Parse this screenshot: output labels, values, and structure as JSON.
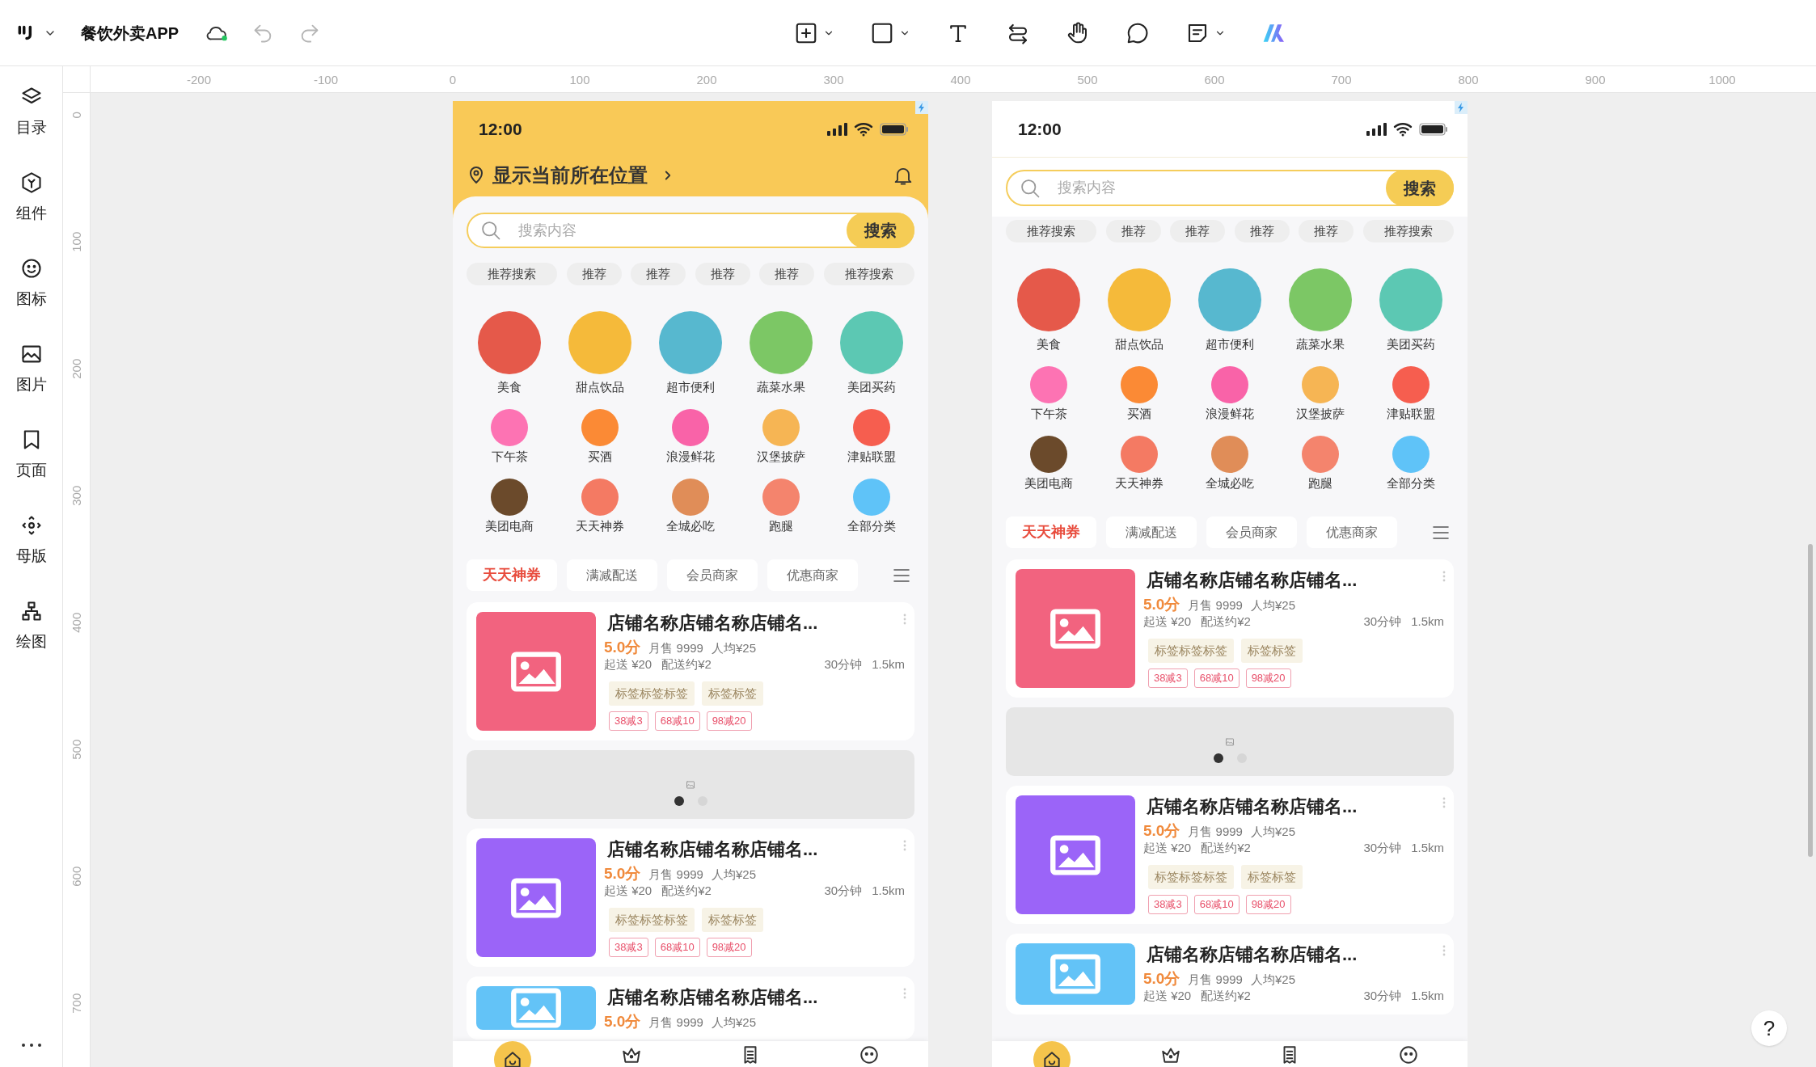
{
  "toolbar": {
    "title": "餐饮外卖APP"
  },
  "sidebar": {
    "items": [
      {
        "label": "目录",
        "kind": "layers"
      },
      {
        "label": "组件",
        "kind": "component"
      },
      {
        "label": "图标",
        "kind": "smiley"
      },
      {
        "label": "图片",
        "kind": "image"
      },
      {
        "label": "页面",
        "kind": "page"
      },
      {
        "label": "母版",
        "kind": "master"
      },
      {
        "label": "绘图",
        "kind": "drawing"
      }
    ]
  },
  "rulers": {
    "horizontal": [
      "-200",
      "-100",
      "0",
      "100",
      "200",
      "300",
      "400",
      "500",
      "600",
      "700",
      "800",
      "900",
      "1000"
    ],
    "vertical": [
      "0",
      "100",
      "200",
      "300",
      "400",
      "500",
      "600",
      "700"
    ]
  },
  "screens": [
    {
      "status_time": "12:00",
      "location": "显示当前所在位置",
      "search": {
        "placeholder": "搜索内容",
        "button": "搜索"
      },
      "chips": [
        "推荐搜索",
        "推荐",
        "推荐",
        "推荐",
        "推荐",
        "推荐搜索"
      ],
      "featured_categories": [
        {
          "label": "美食",
          "color": "#e5594a"
        },
        {
          "label": "甜点饮品",
          "color": "#f5ba3a"
        },
        {
          "label": "超市便利",
          "color": "#57b8cf"
        },
        {
          "label": "蔬菜水果",
          "color": "#7cc765"
        },
        {
          "label": "美团买药",
          "color": "#5cc8b3"
        }
      ],
      "categories": [
        {
          "label": "下午茶",
          "color": "#fd73b3"
        },
        {
          "label": "买酒",
          "color": "#fb8a35"
        },
        {
          "label": "浪漫鲜花",
          "color": "#f963a8"
        },
        {
          "label": "汉堡披萨",
          "color": "#f6b554"
        },
        {
          "label": "津贴联盟",
          "color": "#f65e4f"
        },
        {
          "label": "美团电商",
          "color": "#6b4a2b"
        },
        {
          "label": "天天神券",
          "color": "#f47a63"
        },
        {
          "label": "全城必吃",
          "color": "#e08d58"
        },
        {
          "label": "跑腿",
          "color": "#f4846d"
        },
        {
          "label": "全部分类",
          "color": "#5fc3f8"
        }
      ],
      "filter_tabs": [
        {
          "label": "天天神券",
          "selected": true
        },
        {
          "label": "满减配送",
          "selected": false
        },
        {
          "label": "会员商家",
          "selected": false
        },
        {
          "label": "优惠商家",
          "selected": false
        }
      ],
      "feed": [
        {
          "kind": "store",
          "color": "#f2637f",
          "name": "店铺名称店铺名称店铺名...",
          "rating": "5.0分",
          "sales": "月售 9999",
          "average_price": "人均¥25",
          "minimum_order": "起送 ¥20",
          "delivery_fee": "配送约¥2",
          "delivery_time": "30分钟",
          "distance": "1.5km",
          "tags": [
            "标签标签标签",
            "标签标签"
          ],
          "promotions": [
            "38减3",
            "68减10",
            "98减20"
          ]
        },
        {
          "kind": "banner",
          "dots": [
            {
              "selected": true
            },
            {
              "selected": false
            }
          ]
        },
        {
          "kind": "store",
          "color": "#9b64f8",
          "name": "店铺名称店铺名称店铺名...",
          "rating": "5.0分",
          "sales": "月售 9999",
          "average_price": "人均¥25",
          "minimum_order": "起送 ¥20",
          "delivery_fee": "配送约¥2",
          "delivery_time": "30分钟",
          "distance": "1.5km",
          "tags": [
            "标签标签标签",
            "标签标签"
          ],
          "promotions": [
            "38减3",
            "68减10",
            "98减20"
          ]
        },
        {
          "kind": "store",
          "color": "#63c3f7",
          "name": "店铺名称店铺名称店铺名...",
          "rating": "5.0分",
          "sales": "月售 9999",
          "average_price": "人均¥25"
        }
      ],
      "bottom_nav": [
        {
          "kind": "home",
          "selected": true
        },
        {
          "kind": "crown",
          "selected": false
        },
        {
          "kind": "receipt",
          "selected": false
        },
        {
          "kind": "face",
          "selected": false
        }
      ]
    },
    {
      "status_time": "12:00",
      "search": {
        "placeholder": "搜索内容",
        "button": "搜索"
      },
      "chips": [
        "推荐搜索",
        "推荐",
        "推荐",
        "推荐",
        "推荐",
        "推荐搜索"
      ],
      "featured_categories": [
        {
          "label": "美食",
          "color": "#e5594a"
        },
        {
          "label": "甜点饮品",
          "color": "#f5ba3a"
        },
        {
          "label": "超市便利",
          "color": "#57b8cf"
        },
        {
          "label": "蔬菜水果",
          "color": "#7cc765"
        },
        {
          "label": "美团买药",
          "color": "#5cc8b3"
        }
      ],
      "categories": [
        {
          "label": "下午茶",
          "color": "#fd73b3"
        },
        {
          "label": "买酒",
          "color": "#fb8a35"
        },
        {
          "label": "浪漫鲜花",
          "color": "#f963a8"
        },
        {
          "label": "汉堡披萨",
          "color": "#f6b554"
        },
        {
          "label": "津贴联盟",
          "color": "#f65e4f"
        },
        {
          "label": "美团电商",
          "color": "#6b4a2b"
        },
        {
          "label": "天天神券",
          "color": "#f47a63"
        },
        {
          "label": "全城必吃",
          "color": "#e08d58"
        },
        {
          "label": "跑腿",
          "color": "#f4846d"
        },
        {
          "label": "全部分类",
          "color": "#5fc3f8"
        }
      ],
      "filter_tabs": [
        {
          "label": "天天神券",
          "selected": true
        },
        {
          "label": "满减配送",
          "selected": false
        },
        {
          "label": "会员商家",
          "selected": false
        },
        {
          "label": "优惠商家",
          "selected": false
        }
      ],
      "feed": [
        {
          "kind": "store",
          "color": "#f2637f",
          "name": "店铺名称店铺名称店铺名...",
          "rating": "5.0分",
          "sales": "月售 9999",
          "average_price": "人均¥25",
          "minimum_order": "起送 ¥20",
          "delivery_fee": "配送约¥2",
          "delivery_time": "30分钟",
          "distance": "1.5km",
          "tags": [
            "标签标签标签",
            "标签标签"
          ],
          "promotions": [
            "38减3",
            "68减10",
            "98减20"
          ]
        },
        {
          "kind": "banner",
          "dots": [
            {
              "selected": true
            },
            {
              "selected": false
            }
          ]
        },
        {
          "kind": "store",
          "color": "#9b64f8",
          "name": "店铺名称店铺名称店铺名...",
          "rating": "5.0分",
          "sales": "月售 9999",
          "average_price": "人均¥25",
          "minimum_order": "起送 ¥20",
          "delivery_fee": "配送约¥2",
          "delivery_time": "30分钟",
          "distance": "1.5km",
          "tags": [
            "标签标签标签",
            "标签标签"
          ],
          "promotions": [
            "38减3",
            "68减10",
            "98减20"
          ]
        },
        {
          "kind": "store",
          "color": "#63c3f7",
          "name": "店铺名称店铺名称店铺名...",
          "rating": "5.0分",
          "sales": "月售 9999",
          "average_price": "人均¥25",
          "minimum_order": "起送 ¥20",
          "delivery_fee": "配送约¥2",
          "delivery_time": "30分钟",
          "distance": "1.5km"
        }
      ],
      "bottom_nav": [
        {
          "kind": "home",
          "selected": true
        },
        {
          "kind": "crown",
          "selected": false
        },
        {
          "kind": "receipt",
          "selected": false
        },
        {
          "kind": "face",
          "selected": false
        }
      ]
    }
  ],
  "help_button": "?"
}
